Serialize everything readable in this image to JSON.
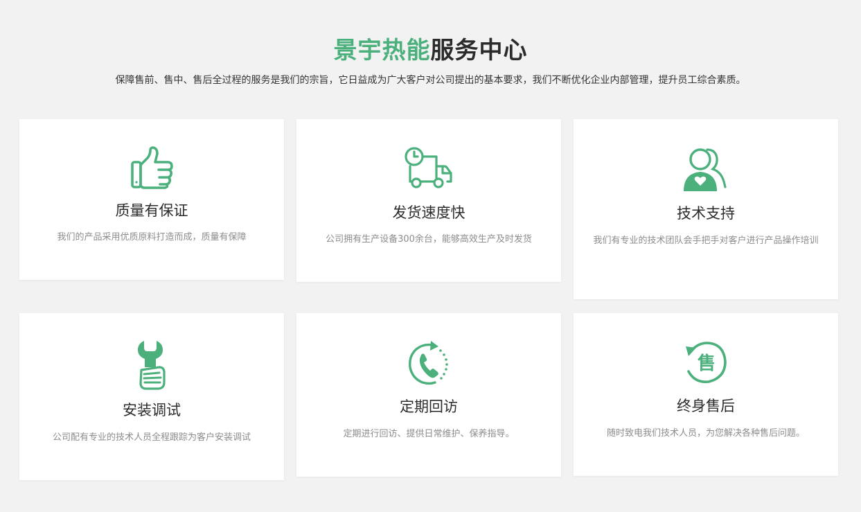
{
  "header": {
    "title_brand": "景宇热能",
    "title_rest": "服务中心",
    "subtitle": "保障售前、售中、售后全过程的服务是我们的宗旨，它日益成为广大客户对公司提出的基本要求，我们不断优化企业内部管理，提升员工综合素质。"
  },
  "colors": {
    "accent": "#4cb07d",
    "background": "#f2f2f2",
    "card": "#ffffff",
    "title_dark": "#2b2b2b",
    "desc_gray": "#8c8c8c"
  },
  "services": [
    {
      "icon": "thumbs-up-icon",
      "title": "质量有保证",
      "desc": "我们的产品采用优质原料打造而成，质量有保障"
    },
    {
      "icon": "delivery-truck-icon",
      "title": "发货速度快",
      "desc": "公司拥有生产设备300余台，能够高效生产及时发货"
    },
    {
      "icon": "support-people-icon",
      "title": "技术支持",
      "desc": "我们有专业的技术团队会手把手对客户进行产品操作培训"
    },
    {
      "icon": "wrench-hand-icon",
      "title": "安装调试",
      "desc": "公司配有专业的技术人员全程跟踪为客户安装调试"
    },
    {
      "icon": "phone-callback-icon",
      "title": "定期回访",
      "desc": "定期进行回访、提供日常维护、保养指导。"
    },
    {
      "icon": "after-sales-icon",
      "title": "终身售后",
      "desc": "随时致电我们技术人员，为您解决各种售后问题。",
      "icon_text": "售"
    }
  ]
}
